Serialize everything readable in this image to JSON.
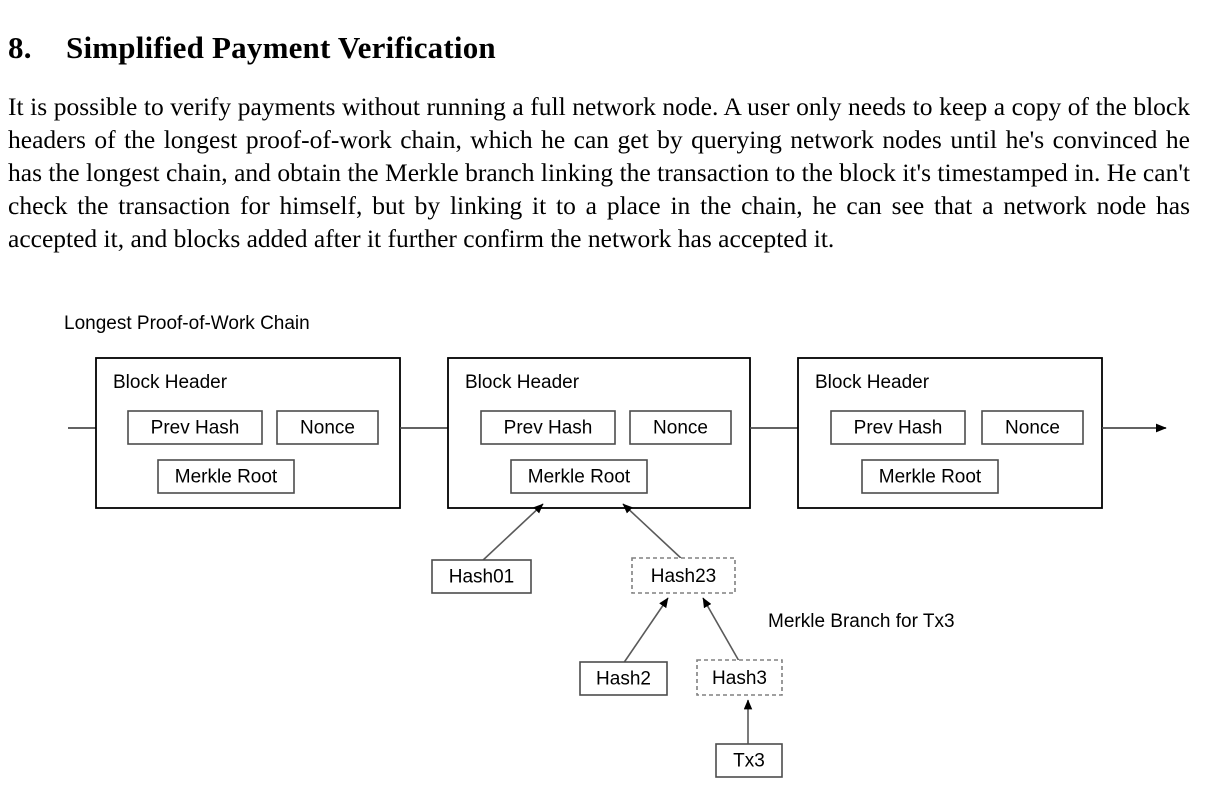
{
  "document": {
    "section_number": "8.",
    "section_title": "Simplified Payment Verification",
    "paragraph": "It is possible to verify payments without running a full network node.  A user only needs to keep a copy of the block headers of the longest proof-of-work chain, which he can get by querying network nodes until he's convinced he has the longest chain, and obtain the Merkle branch linking the transaction to the block it's timestamped in.  He can't check the transaction for himself, but by linking it to a place in the chain, he can see that a network node has accepted it, and blocks added after it further confirm the network has accepted it."
  },
  "figure": {
    "chain_label": "Longest Proof-of-Work Chain",
    "branch_label": "Merkle Branch for Tx3",
    "blocks": [
      {
        "header_label": "Block Header",
        "prev_hash_label": "Prev Hash",
        "nonce_label": "Nonce",
        "merkle_root_label": "Merkle Root"
      },
      {
        "header_label": "Block Header",
        "prev_hash_label": "Prev Hash",
        "nonce_label": "Nonce",
        "merkle_root_label": "Merkle Root"
      },
      {
        "header_label": "Block Header",
        "prev_hash_label": "Prev Hash",
        "nonce_label": "Nonce",
        "merkle_root_label": "Merkle Root"
      }
    ],
    "merkle_nodes": [
      {
        "label": "Hash01",
        "style": "solid"
      },
      {
        "label": "Hash23",
        "style": "dashed"
      },
      {
        "label": "Hash2",
        "style": "solid"
      },
      {
        "label": "Hash3",
        "style": "dashed"
      },
      {
        "label": "Tx3",
        "style": "solid"
      }
    ],
    "colors": {
      "ink": "#000000",
      "box_stroke": "#4d4d4d",
      "dashed_stroke": "#808080",
      "background": "#ffffff"
    }
  }
}
